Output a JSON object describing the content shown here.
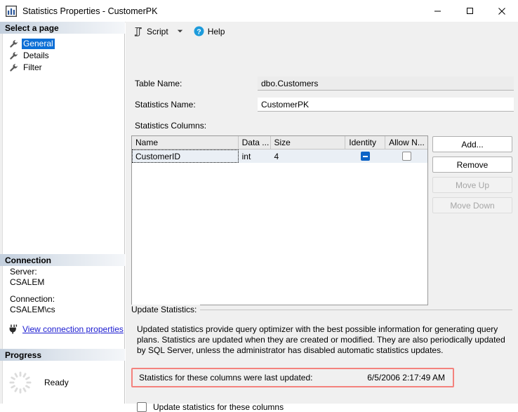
{
  "window": {
    "title": "Statistics Properties - CustomerPK",
    "icon": "statistics-chart-icon",
    "minimize": "─",
    "maximize": "□",
    "close": "✕"
  },
  "sidebar": {
    "select_page_header": "Select a page",
    "pages": [
      {
        "label": "General",
        "selected": true
      },
      {
        "label": "Details",
        "selected": false
      },
      {
        "label": "Filter",
        "selected": false
      }
    ],
    "connection": {
      "header": "Connection",
      "server_label": "Server:",
      "server_value": "CSALEM",
      "connection_label": "Connection:",
      "connection_value": "CSALEM\\cs",
      "link_text": "View connection properties"
    },
    "progress": {
      "header": "Progress",
      "status": "Ready"
    }
  },
  "toolbar": {
    "script_label": "Script",
    "help_label": "Help"
  },
  "form": {
    "table_name_label": "Table Name:",
    "table_name_value": "dbo.Customers",
    "statistics_name_label": "Statistics Name:",
    "statistics_name_value": "CustomerPK",
    "statistics_columns_label": "Statistics Columns:"
  },
  "grid": {
    "columns": [
      "Name",
      "Data ...",
      "Size",
      "Identity",
      "Allow N..."
    ],
    "rows": [
      {
        "name": "CustomerID",
        "data_type": "int",
        "size": "4",
        "identity": "indeterminate",
        "allow_nulls": "unchecked"
      }
    ]
  },
  "buttons": {
    "add": "Add...",
    "remove": "Remove",
    "move_up": "Move Up",
    "move_down": "Move Down"
  },
  "update_statistics": {
    "group_label": "Update Statistics:",
    "description": "Updated statistics provide query optimizer with the best possible information for generating query plans. Statistics are updated when they are created or modified. They are also periodically updated by SQL Server, unless the administrator has disabled automatic statistics updates.",
    "last_updated_label": "Statistics for these columns were last updated:",
    "last_updated_value": "6/5/2006 2:17:49 AM",
    "update_checkbox_label": "Update statistics for these columns"
  },
  "colors": {
    "selection_blue": "#0d6fd6",
    "link_blue": "#1a1ad0",
    "checkbox_blue": "#0d63c6",
    "highlight_red": "#f4827d",
    "panel_gray": "#f0f0f0"
  }
}
